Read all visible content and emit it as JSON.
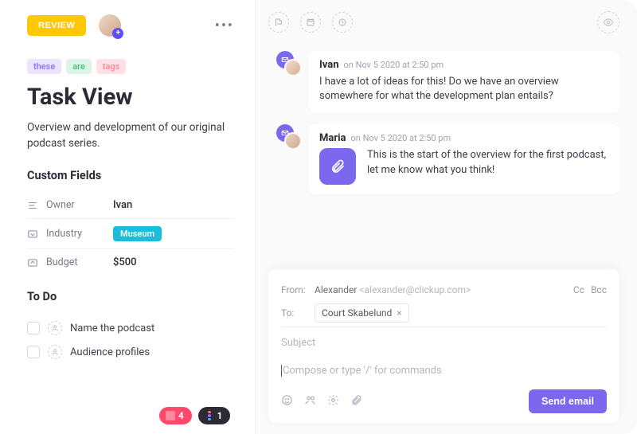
{
  "header": {
    "review_label": "REVIEW"
  },
  "tags": [
    "these",
    "are",
    "tags"
  ],
  "title": "Task View",
  "description": "Overview and development of our original podcast series.",
  "custom_fields_heading": "Custom Fields",
  "fields": {
    "owner": {
      "label": "Owner",
      "value": "Ivan"
    },
    "industry": {
      "label": "Industry",
      "value": "Museum"
    },
    "budget": {
      "label": "Budget",
      "value": "$500"
    }
  },
  "todo_heading": "To Do",
  "todos": [
    {
      "text": "Name the podcast"
    },
    {
      "text": "Audience profiles"
    }
  ],
  "comments": [
    {
      "author": "Ivan",
      "timestamp": "on Nov 5 2020 at 2:50 pm",
      "text": "I have a lot of ideas for this! Do we have an overview somewhere for what the development plan entails?"
    },
    {
      "author": "Maria",
      "timestamp": "on Nov 5 2020 at 2:50 pm",
      "text": "This is the start of the overview for the first podcast, let me know what you think!"
    }
  ],
  "composer": {
    "from_label": "From:",
    "from_name": "Alexander",
    "from_email": "<alexander@clickup.com>",
    "to_label": "To:",
    "to_chip": "Court Skabelund",
    "cc_label": "Cc",
    "bcc_label": "Bcc",
    "subject_placeholder": "Subject",
    "body_placeholder": "Compose or type '/' for commands",
    "send_label": "Send email"
  },
  "bottom_pills": {
    "pink_count": "4",
    "dark_count": "1"
  }
}
